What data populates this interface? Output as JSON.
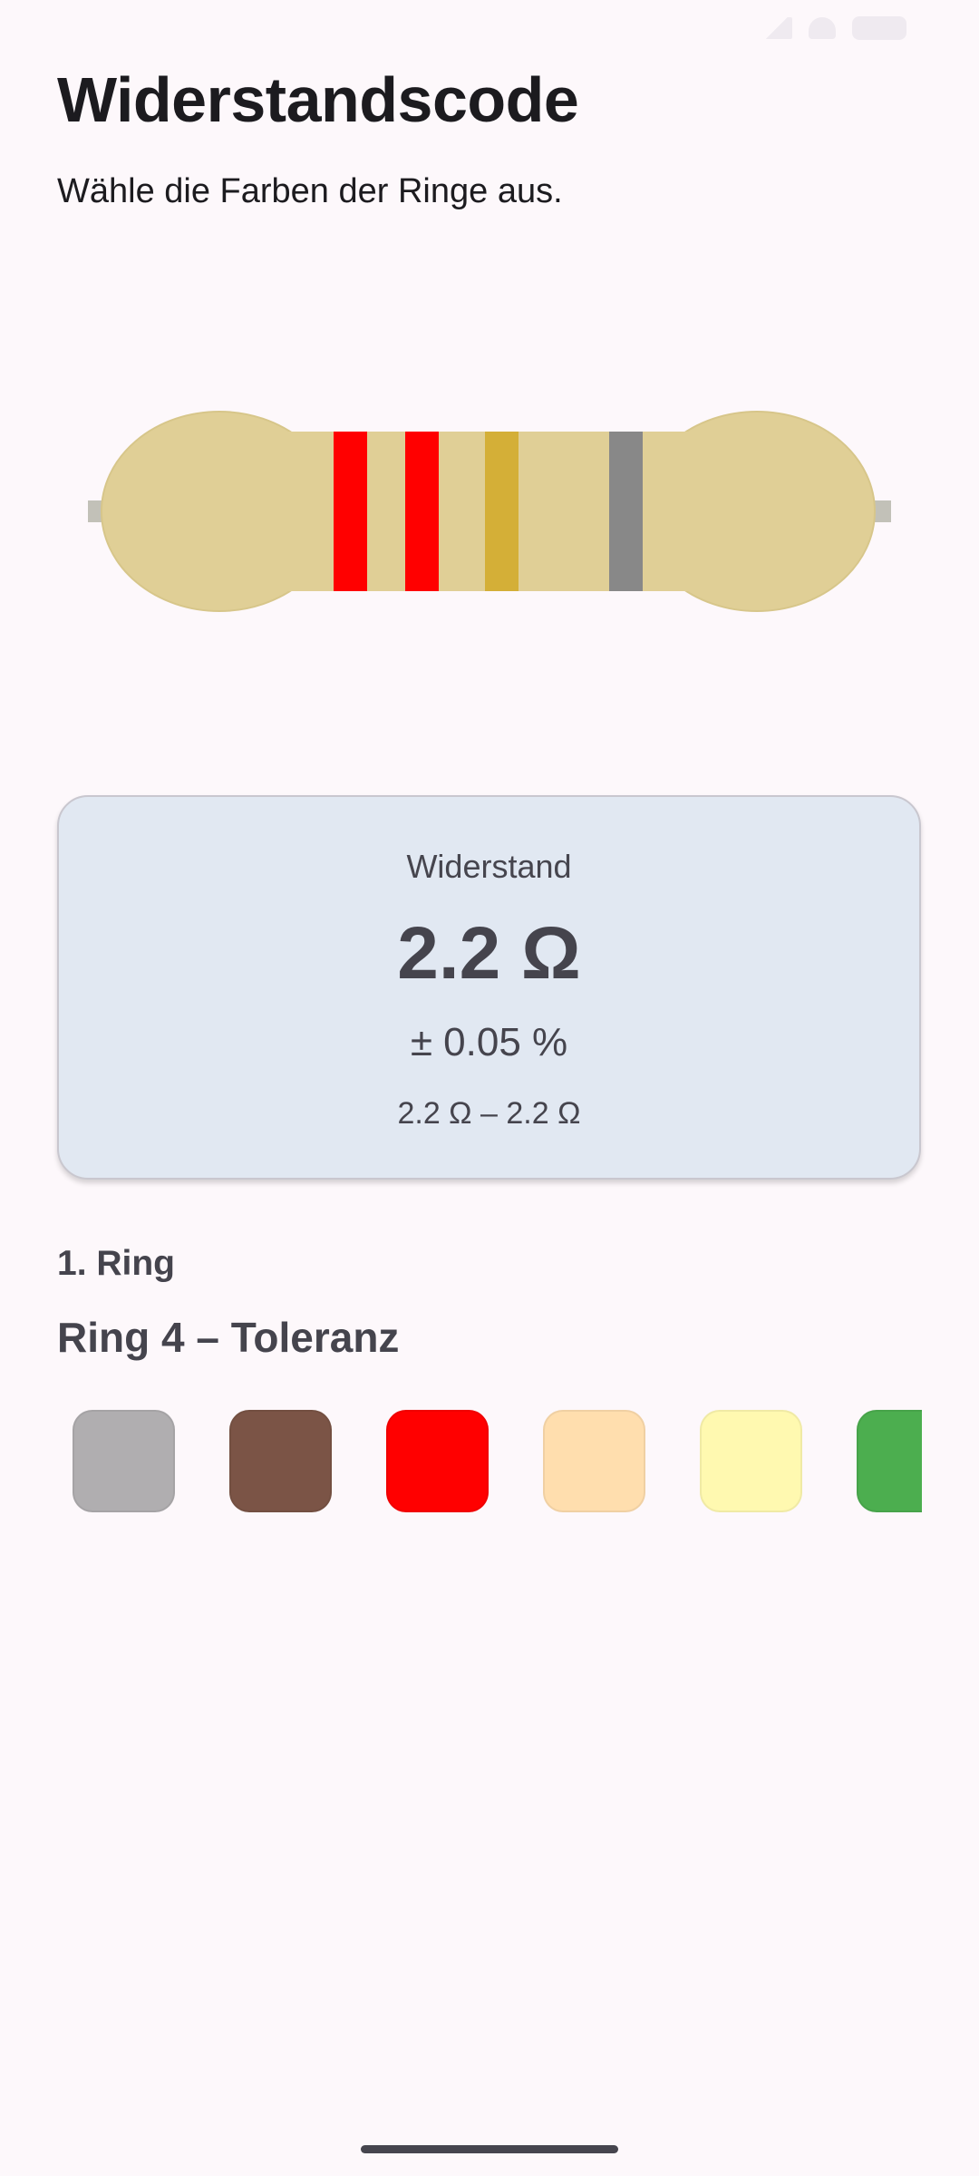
{
  "app": {
    "title": "Widerstandscode",
    "subtitle": "Wähle die Farben der Ringe aus."
  },
  "resistor": {
    "body_color": "#e0cf96",
    "lead_color": "#c2c1b8",
    "bands": [
      {
        "name": "red",
        "color": "#ff0000"
      },
      {
        "name": "red",
        "color": "#ff0000"
      },
      {
        "name": "gold",
        "color": "#d4af37"
      },
      {
        "name": "gray",
        "color": "#888888"
      }
    ]
  },
  "result": {
    "label": "Widerstand",
    "value": "2.2 Ω",
    "tolerance": "± 0.05 %",
    "range": "2.2 Ω – 2.2 Ω"
  },
  "ring_picker": {
    "heading": "1. Ring",
    "title": "Ring 4 – Toleranz",
    "swatches": [
      {
        "name": "silver",
        "color": "#b0aeb0"
      },
      {
        "name": "brown",
        "color": "#7b5446"
      },
      {
        "name": "red",
        "color": "#ff0000"
      },
      {
        "name": "orange-light",
        "color": "#ffdeae"
      },
      {
        "name": "yellow-light",
        "color": "#fff9b0"
      },
      {
        "name": "green",
        "color": "#4cae4f"
      }
    ]
  }
}
